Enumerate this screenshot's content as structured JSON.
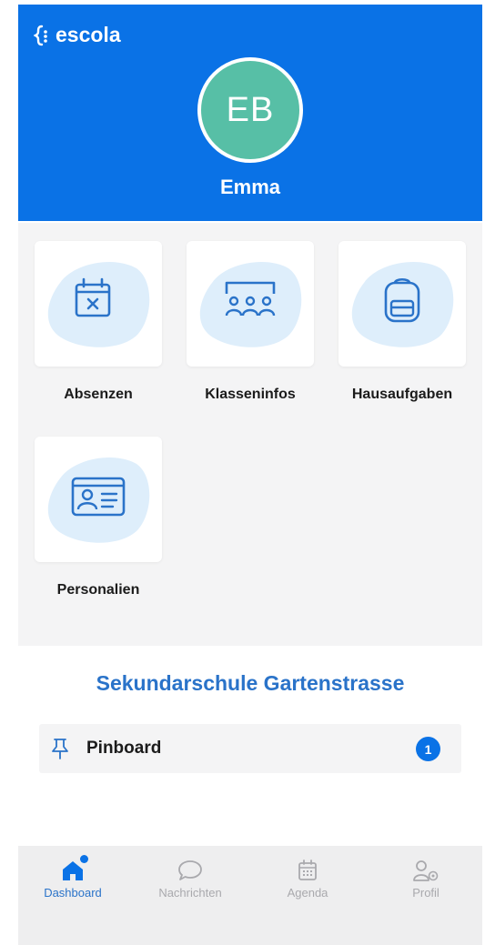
{
  "header": {
    "brand": "escola",
    "avatar_initials": "EB",
    "user_name": "Emma"
  },
  "tiles": [
    {
      "label": "Absenzen",
      "icon": "calendar-x-icon"
    },
    {
      "label": "Klasseninfos",
      "icon": "class-group-icon"
    },
    {
      "label": "Hausaufgaben",
      "icon": "backpack-icon"
    },
    {
      "label": "Personalien",
      "icon": "id-card-icon"
    }
  ],
  "school": {
    "name": "Sekundarschule Gartenstrasse",
    "pinboard_label": "Pinboard",
    "pinboard_count": "1"
  },
  "nav": [
    {
      "label": "Dashboard",
      "icon": "home-icon",
      "active": true
    },
    {
      "label": "Nachrichten",
      "icon": "chat-bubble-icon",
      "active": false
    },
    {
      "label": "Agenda",
      "icon": "calendar-icon",
      "active": false
    },
    {
      "label": "Profil",
      "icon": "profile-settings-icon",
      "active": false
    }
  ],
  "colors": {
    "primary": "#0a72e6",
    "avatar": "#57bfa6",
    "accent_text": "#2a73c9",
    "inactive": "#a9a9ad"
  }
}
